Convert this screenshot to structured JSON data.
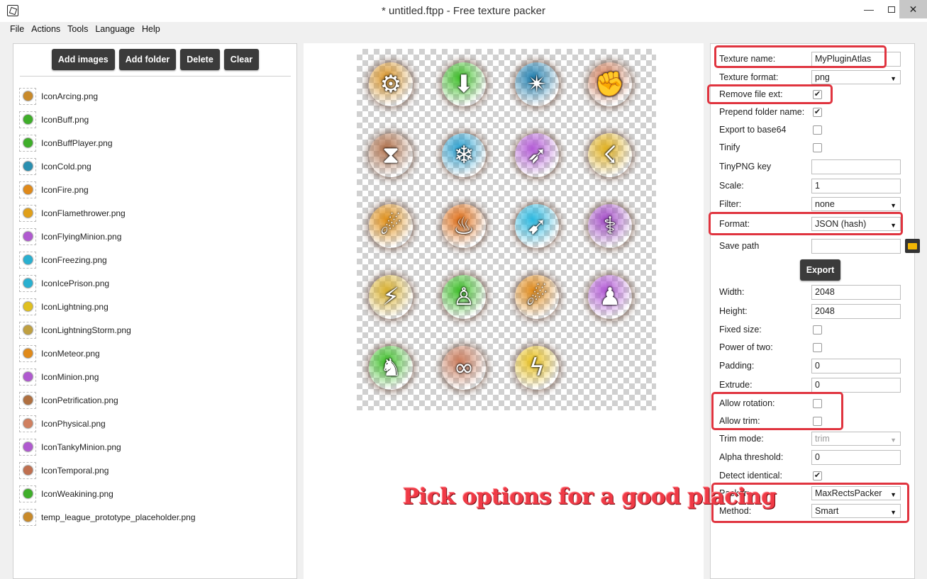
{
  "window": {
    "title": "* untitled.ftpp - Free texture packer",
    "minimize": "—",
    "close": "✕"
  },
  "menu": [
    "File",
    "Actions",
    "Tools",
    "Language",
    "Help"
  ],
  "toolbar": {
    "add_images": "Add images",
    "add_folder": "Add folder",
    "delete": "Delete",
    "clear": "Clear"
  },
  "files": [
    {
      "name": "IconArcing.png",
      "color": "#c98a2a"
    },
    {
      "name": "IconBuff.png",
      "color": "#3fae2a"
    },
    {
      "name": "IconBuffPlayer.png",
      "color": "#3fae2a"
    },
    {
      "name": "IconCold.png",
      "color": "#2a8fb0"
    },
    {
      "name": "IconFire.png",
      "color": "#e08a1a"
    },
    {
      "name": "IconFlamethrower.png",
      "color": "#e0a01a"
    },
    {
      "name": "IconFlyingMinion.png",
      "color": "#b05ad0"
    },
    {
      "name": "IconFreezing.png",
      "color": "#2ab0d0"
    },
    {
      "name": "IconIcePrison.png",
      "color": "#2ab0d0"
    },
    {
      "name": "IconLightning.png",
      "color": "#e0c020"
    },
    {
      "name": "IconLightningStorm.png",
      "color": "#c0a040"
    },
    {
      "name": "IconMeteor.png",
      "color": "#e08a1a"
    },
    {
      "name": "IconMinion.png",
      "color": "#b05ad0"
    },
    {
      "name": "IconPetrification.png",
      "color": "#b07040"
    },
    {
      "name": "IconPhysical.png",
      "color": "#d08060"
    },
    {
      "name": "IconTankyMinion.png",
      "color": "#b05ad0"
    },
    {
      "name": "IconTemporal.png",
      "color": "#c07050"
    },
    {
      "name": "IconWeakining.png",
      "color": "#3fae2a"
    },
    {
      "name": "temp_league_prototype_placeholder.png",
      "color": "#c98a2a"
    }
  ],
  "atlas_icons": [
    {
      "name": "gear-arrow-icon",
      "glyph": "⚙",
      "color": "#d9952a"
    },
    {
      "name": "buff-arrow-icon",
      "glyph": "⬇",
      "color": "#3fbf2a"
    },
    {
      "name": "shuriken-icon",
      "glyph": "✴",
      "color": "#1f7fb0"
    },
    {
      "name": "fist-icon",
      "glyph": "✊",
      "color": "#d07a55"
    },
    {
      "name": "hourglass-icon",
      "glyph": "⧗",
      "color": "#b0704a"
    },
    {
      "name": "snowflake-icon",
      "glyph": "❄",
      "color": "#2aa0d0"
    },
    {
      "name": "wing-icon",
      "glyph": "➶",
      "color": "#b35ad6"
    },
    {
      "name": "storm-icon",
      "glyph": "☇",
      "color": "#e0b020"
    },
    {
      "name": "flamethrower-icon",
      "glyph": "☄",
      "color": "#e0901a"
    },
    {
      "name": "fire-icon",
      "glyph": "♨",
      "color": "#e0701a"
    },
    {
      "name": "ice-shards-icon",
      "glyph": "➹",
      "color": "#2ab8e0"
    },
    {
      "name": "tentacle-icon",
      "glyph": "⚕",
      "color": "#a24ac6"
    },
    {
      "name": "lightning-storm-icon",
      "glyph": "⚡",
      "color": "#d8b030"
    },
    {
      "name": "buff-player-icon",
      "glyph": "♙",
      "color": "#3fbf2a"
    },
    {
      "name": "meteor-icon",
      "glyph": "☄",
      "color": "#e08a1a"
    },
    {
      "name": "minion-icon",
      "glyph": "♟",
      "color": "#b35ad6"
    },
    {
      "name": "muscle-icon",
      "glyph": "♞",
      "color": "#3fbf2a"
    },
    {
      "name": "temporal-icon",
      "glyph": "∞",
      "color": "#c97a5a"
    },
    {
      "name": "lightning-icon",
      "glyph": "ϟ",
      "color": "#e8c020"
    }
  ],
  "settings": {
    "texture_name": {
      "label": "Texture name:",
      "value": "MyPluginAtlas"
    },
    "texture_format": {
      "label": "Texture format:",
      "value": "png"
    },
    "remove_file_ext": {
      "label": "Remove file ext:",
      "checked": "✔"
    },
    "prepend_folder": {
      "label": "Prepend folder name:",
      "checked": "✔"
    },
    "export_base64": {
      "label": "Export to base64"
    },
    "tinify": {
      "label": "Tinify"
    },
    "tinypng_key": {
      "label": "TinyPNG key",
      "value": ""
    },
    "scale": {
      "label": "Scale:",
      "value": "1"
    },
    "filter": {
      "label": "Filter:",
      "value": "none"
    },
    "format": {
      "label": "Format:",
      "value": "JSON (hash)"
    },
    "save_path": {
      "label": "Save path",
      "value": ""
    },
    "export": "Export",
    "width": {
      "label": "Width:",
      "value": "2048"
    },
    "height": {
      "label": "Height:",
      "value": "2048"
    },
    "fixed_size": {
      "label": "Fixed size:"
    },
    "power_of_two": {
      "label": "Power of two:"
    },
    "padding": {
      "label": "Padding:",
      "value": "0"
    },
    "extrude": {
      "label": "Extrude:",
      "value": "0"
    },
    "allow_rotation": {
      "label": "Allow rotation:"
    },
    "allow_trim": {
      "label": "Allow trim:"
    },
    "trim_mode": {
      "label": "Trim mode:",
      "value": "trim"
    },
    "alpha_threshold": {
      "label": "Alpha threshold:",
      "value": "0"
    },
    "detect_identical": {
      "label": "Detect identical:",
      "checked": "✔"
    },
    "packer": {
      "label": "Packer:",
      "value": "MaxRectsPacker"
    },
    "method": {
      "label": "Method:",
      "value": "Smart"
    }
  },
  "annotation": "Pick options for a good placing",
  "colors": {
    "highlight": "#e0343f",
    "button": "#3b3b3b",
    "annotation": "#f03a46"
  }
}
